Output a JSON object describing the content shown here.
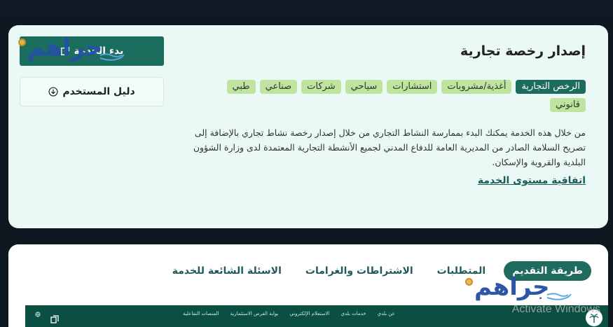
{
  "service": {
    "title": "إصدار رخصة تجارية",
    "tags": [
      {
        "label": "الرخص التجارية",
        "active": true
      },
      {
        "label": "أغذية/مشروبات",
        "active": false
      },
      {
        "label": "استشارات",
        "active": false
      },
      {
        "label": "سياحي",
        "active": false
      },
      {
        "label": "شركات",
        "active": false
      },
      {
        "label": "صناعي",
        "active": false
      },
      {
        "label": "طبي",
        "active": false
      },
      {
        "label": "قانوني",
        "active": false
      }
    ],
    "description": "من خلال هذه الخدمة يمكنك البدء بممارسة النشاط التجاري من خلال إصدار رخصة نشاط تجاري بالإضافة إلى تصريح السلامة الصادر من المديرية العامة للدفاع المدني لجميع الأنشطة التجارية المعتمدة لدى وزارة الشؤون البلدية والقروية والإسكان.",
    "sla_link": "اتفاقية مستوى الخدمة"
  },
  "actions": {
    "start_label": "بدء الخدمة",
    "guide_label": "دليل المستخدم"
  },
  "tabs": [
    {
      "label": "طريقة التقديم",
      "active": true
    },
    {
      "label": "المتطلبات",
      "active": false
    },
    {
      "label": "الاشتراطات والغرامات",
      "active": false
    },
    {
      "label": "الاسئلة الشائعة للخدمة",
      "active": false
    }
  ],
  "embedded_nav": [
    "عن بلدي",
    "خدمات بلدي",
    "الاستعلام الإلكتروني",
    "بوابة الفرص الاستثمارية",
    "المنصات التفاعلية"
  ],
  "watermark": {
    "logo_text": "جراهم",
    "os_text": "Activate Windows"
  },
  "colors": {
    "primary": "#1b6d5e",
    "tag_bg": "#bfe4a0",
    "panel_bg": "#eaf8f6",
    "link": "#1d5d57"
  }
}
